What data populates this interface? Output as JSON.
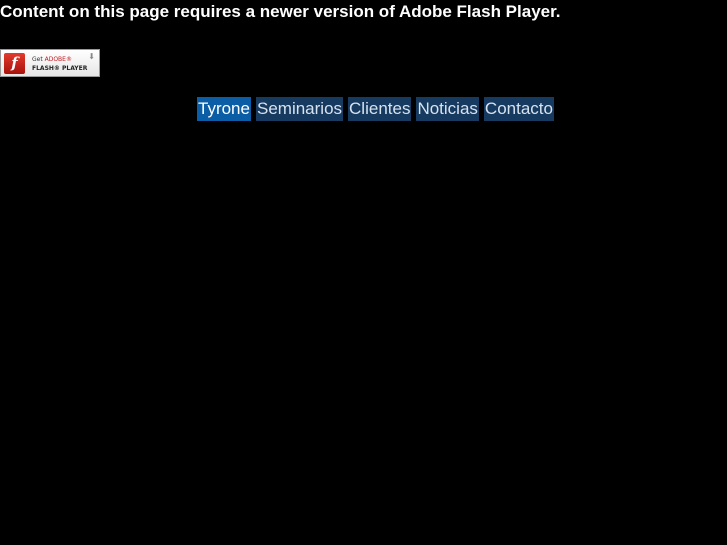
{
  "notice": {
    "text": "Content on this page requires a newer version of Adobe Flash Player."
  },
  "flash_badge": {
    "get": "Get ",
    "brand": "ADOBE®",
    "product": "FLASH® PLAYER",
    "logo_letter": "f",
    "arrow": "⬇"
  },
  "nav": {
    "items": [
      {
        "label": "Tyrone",
        "active": true
      },
      {
        "label": "Seminarios",
        "active": false
      },
      {
        "label": "Clientes",
        "active": false
      },
      {
        "label": "Noticias",
        "active": false
      },
      {
        "label": "Contacto",
        "active": false
      }
    ]
  },
  "colors": {
    "background": "#000000",
    "nav_active": "#0b5ea6",
    "nav_default": "#173a60",
    "flash_red": "#c4161c"
  }
}
